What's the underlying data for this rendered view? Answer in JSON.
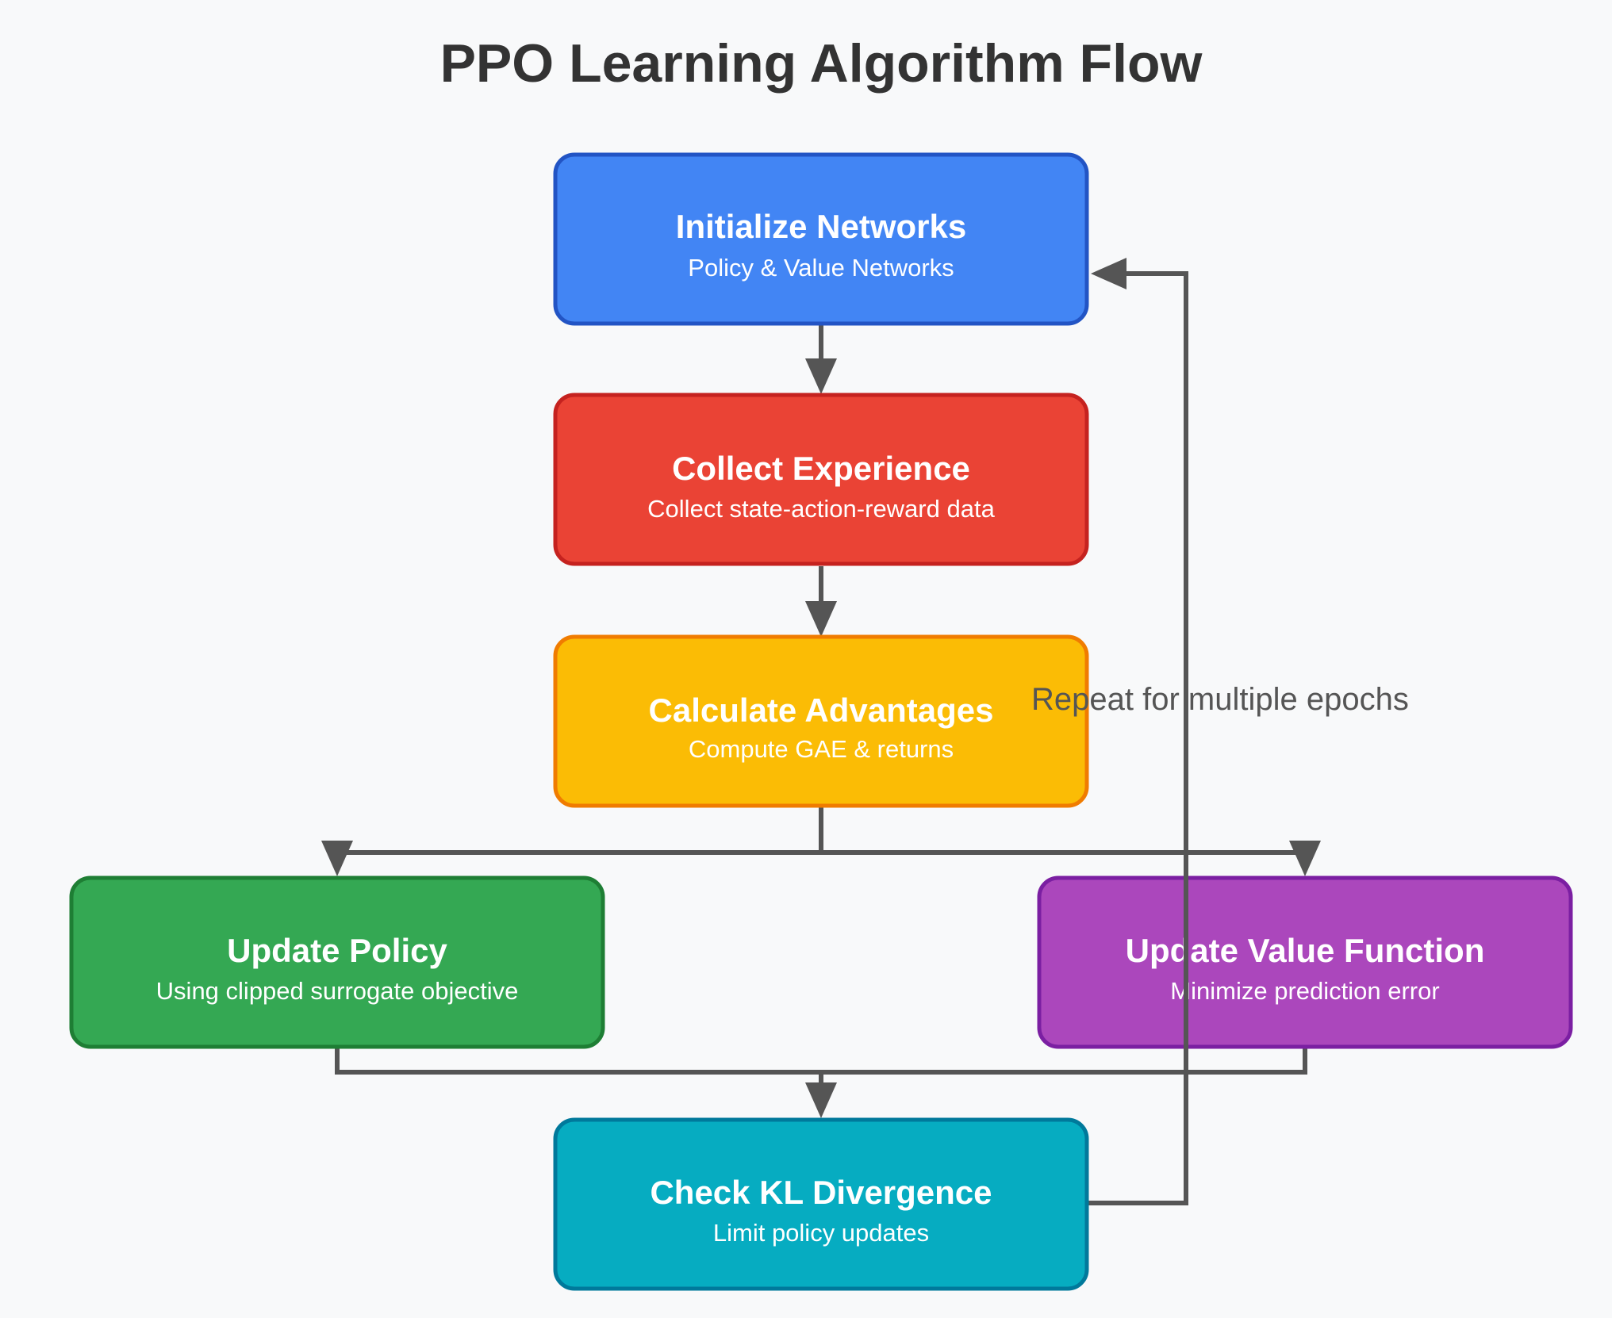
{
  "title": "PPO Learning Algorithm Flow",
  "colors": {
    "background": "#f8f9fa",
    "title_text": "#333333",
    "edge": "#555555"
  },
  "nodes": {
    "init": {
      "title": "Initialize Networks",
      "subtitle": "Policy & Value Networks",
      "fill": "#4285f4",
      "stroke": "#2254c4"
    },
    "collect": {
      "title": "Collect Experience",
      "subtitle": "Collect state-action-reward data",
      "fill": "#ea4335",
      "stroke": "#c5221f"
    },
    "advantages": {
      "title": "Calculate Advantages",
      "subtitle": "Compute GAE & returns",
      "fill": "#fbbc05",
      "stroke": "#f07c00"
    },
    "policy": {
      "title": "Update Policy",
      "subtitle": "Using clipped surrogate objective",
      "fill": "#34a853",
      "stroke": "#1e7e34"
    },
    "value": {
      "title": "Update Value Function",
      "subtitle": "Minimize prediction error",
      "fill": "#ab47bc",
      "stroke": "#7b1fa2"
    },
    "kl": {
      "title": "Check KL Divergence",
      "subtitle": "Limit policy updates",
      "fill": "#06acc1",
      "stroke": "#00799b"
    }
  },
  "edges": {
    "loop_label": "Repeat for multiple epochs"
  }
}
